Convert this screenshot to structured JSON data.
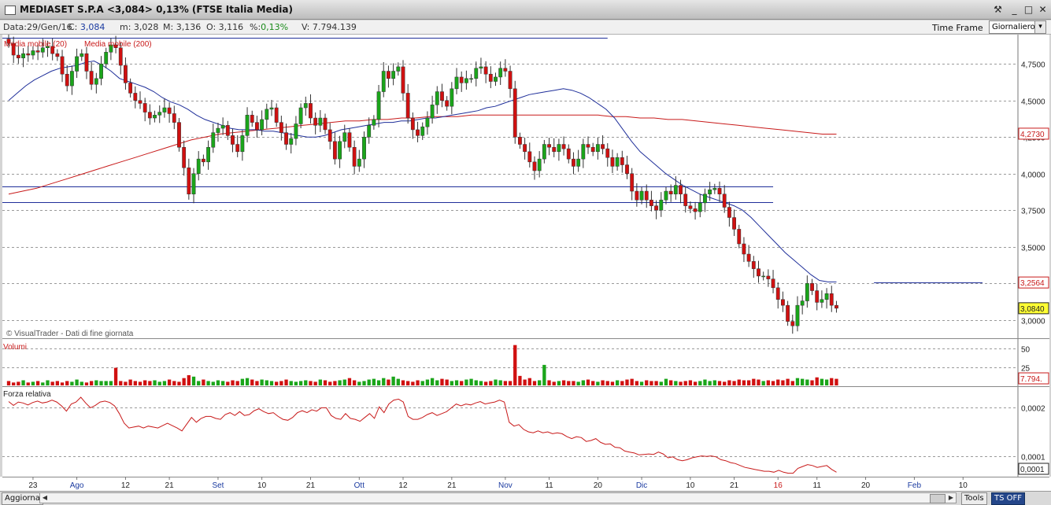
{
  "window": {
    "title": "MEDIASET S.P.A <3,084> 0,13%  (FTSE Italia Media)",
    "controls": [
      "⚒",
      "_",
      "□",
      "✕"
    ]
  },
  "info": {
    "data_label": "Data:",
    "data_value": "29/Gen/16",
    "c_label": "C:",
    "c_value": "3,084",
    "m_label": "m:",
    "m_value": "3,028",
    "M_label": "M:",
    "M_value": "3,136",
    "o_label": "O:",
    "o_value": "3,116",
    "pct_label": "%:",
    "pct_value": "0,13%",
    "v_label": "V:",
    "v_value": "7.794.139"
  },
  "timeframe": {
    "label": "Time Frame",
    "value": "Giornaliero"
  },
  "bottom": {
    "update_button": "Aggiorna",
    "tools_button": "Tools",
    "ts_button": "TS OFF"
  },
  "colors": {
    "up": "#1aa51a",
    "down": "#d01010",
    "ma20": "#1f2f9a",
    "ma200": "#c81a1a",
    "grid": "#9a9a9a"
  },
  "chart_data": [
    {
      "type": "candlestick",
      "legend": [
        "Media mobile (20)",
        "Media mobile (200)"
      ],
      "watermark": "© VisualTrader - Dati di fine giornata",
      "yticks": [
        "4,7500",
        "4,5000",
        "4,2500",
        "4,0000",
        "3,7500",
        "3,5000",
        "3,2500",
        "3,0000"
      ],
      "ylim": [
        2.875,
        4.95
      ],
      "x_labels": [
        "23",
        "Ago",
        "12",
        "21",
        "Set",
        "10",
        "21",
        "Ott",
        "12",
        "21",
        "Nov",
        "11",
        "20",
        "Dic",
        "10",
        "21",
        "16",
        "11",
        "20",
        "Feb",
        "10"
      ],
      "x_label_index": [
        5,
        14,
        24,
        33,
        43,
        52,
        62,
        72,
        81,
        91,
        102,
        111,
        121,
        130,
        140,
        149,
        158,
        166,
        176,
        186,
        196
      ],
      "value_badges": {
        "ma200": "4,2730",
        "ma20": "3,2564",
        "last": "3,0840"
      },
      "ma20_end": 3.256,
      "ma200_end": 4.273,
      "hlines": [
        {
          "level": 4.93,
          "x0": 0,
          "x1": 123
        },
        {
          "level": 3.915,
          "x0": 0,
          "x1": 157
        },
        {
          "level": 3.805,
          "x0": 0,
          "x1": 157
        },
        {
          "level": 3.254,
          "x0": 179,
          "x1": 200
        }
      ],
      "close": [
        4.89,
        4.81,
        4.79,
        4.82,
        4.81,
        4.84,
        4.83,
        4.86,
        4.87,
        4.82,
        4.8,
        4.68,
        4.6,
        4.7,
        4.8,
        4.82,
        4.7,
        4.61,
        4.65,
        4.75,
        4.83,
        4.88,
        4.86,
        4.74,
        4.62,
        4.55,
        4.5,
        4.48,
        4.42,
        4.38,
        4.4,
        4.42,
        4.45,
        4.41,
        4.35,
        4.18,
        4.04,
        3.86,
        4.0,
        4.1,
        4.08,
        4.18,
        4.28,
        4.31,
        4.33,
        4.26,
        4.2,
        4.15,
        4.26,
        4.4,
        4.35,
        4.3,
        4.37,
        4.44,
        4.45,
        4.35,
        4.28,
        4.2,
        4.24,
        4.34,
        4.45,
        4.48,
        4.38,
        4.33,
        4.38,
        4.3,
        4.22,
        4.1,
        4.22,
        4.28,
        4.18,
        4.05,
        4.1,
        4.25,
        4.33,
        4.37,
        4.56,
        4.7,
        4.65,
        4.7,
        4.73,
        4.55,
        4.38,
        4.3,
        4.26,
        4.32,
        4.38,
        4.47,
        4.56,
        4.5,
        4.46,
        4.58,
        4.66,
        4.62,
        4.65,
        4.65,
        4.72,
        4.73,
        4.68,
        4.63,
        4.66,
        4.72,
        4.7,
        4.58,
        4.25,
        4.2,
        4.15,
        4.08,
        4.02,
        4.1,
        4.2,
        4.18,
        4.15,
        4.2,
        4.17,
        4.1,
        4.05,
        4.1,
        4.2,
        4.18,
        4.15,
        4.2,
        4.17,
        4.11,
        4.05,
        4.11,
        4.06,
        4.0,
        3.88,
        3.82,
        3.88,
        3.82,
        3.78,
        3.75,
        3.82,
        3.88,
        3.86,
        3.92,
        3.86,
        3.78,
        3.76,
        3.74,
        3.8,
        3.86,
        3.89,
        3.9,
        3.86,
        3.77,
        3.7,
        3.62,
        3.52,
        3.45,
        3.4,
        3.35,
        3.3,
        3.3,
        3.28,
        3.22,
        3.14,
        3.1,
        2.99,
        2.96,
        3.1,
        3.13,
        3.25,
        3.2,
        3.12,
        3.14,
        3.18,
        3.1,
        3.08
      ],
      "ma20": [
        4.5,
        4.55,
        4.6,
        4.64,
        4.67,
        4.7,
        4.72,
        4.73,
        4.74,
        4.76,
        4.77,
        4.74,
        4.7,
        4.65,
        4.63,
        4.61,
        4.59,
        4.56,
        4.52,
        4.49,
        4.47,
        4.44,
        4.4,
        4.37,
        4.35,
        4.33,
        4.31,
        4.3,
        4.3,
        4.3,
        4.29,
        4.29,
        4.28,
        4.27,
        4.26,
        4.25,
        4.25,
        4.26,
        4.28,
        4.3,
        4.31,
        4.32,
        4.33,
        4.34,
        4.35,
        4.35,
        4.36,
        4.36,
        4.37,
        4.38,
        4.38,
        4.39,
        4.4,
        4.41,
        4.42,
        4.43,
        4.45,
        4.46,
        4.48,
        4.5,
        4.52,
        4.54,
        4.55,
        4.56,
        4.57,
        4.58,
        4.57,
        4.55,
        4.52,
        4.48,
        4.44,
        4.38,
        4.3,
        4.22,
        4.15,
        4.1,
        4.05,
        4.0,
        3.96,
        3.92,
        3.89,
        3.86,
        3.84,
        3.82,
        3.8,
        3.78,
        3.75,
        3.7,
        3.64,
        3.58,
        3.52,
        3.46,
        3.41,
        3.36,
        3.31,
        3.27,
        3.26,
        3.26
      ],
      "ma200": [
        3.86,
        3.88,
        3.9,
        3.93,
        3.96,
        3.99,
        4.02,
        4.05,
        4.08,
        4.11,
        4.14,
        4.17,
        4.2,
        4.23,
        4.25,
        4.27,
        4.28,
        4.29,
        4.3,
        4.31,
        4.32,
        4.33,
        4.34,
        4.35,
        4.36,
        4.36,
        4.37,
        4.37,
        4.38,
        4.38,
        4.39,
        4.39,
        4.39,
        4.4,
        4.4,
        4.4,
        4.4,
        4.4,
        4.4,
        4.4,
        4.4,
        4.4,
        4.4,
        4.39,
        4.39,
        4.38,
        4.38,
        4.37,
        4.37,
        4.36,
        4.35,
        4.34,
        4.33,
        4.32,
        4.31,
        4.3,
        4.29,
        4.28,
        4.27,
        4.27
      ],
      "ma200_start": 0
    },
    {
      "type": "bar",
      "title": "Volumi",
      "yticks": [
        "50",
        "25"
      ],
      "ylim": [
        0,
        60
      ],
      "value_badge": "7.794.",
      "values": [
        6,
        4,
        5,
        7,
        4,
        5,
        6,
        4,
        7,
        5,
        6,
        4,
        6,
        5,
        8,
        5,
        4,
        6,
        7,
        6,
        6,
        6,
        24,
        6,
        5,
        8,
        6,
        5,
        7,
        6,
        7,
        5,
        6,
        8,
        6,
        5,
        10,
        14,
        12,
        6,
        8,
        6,
        5,
        7,
        6,
        5,
        7,
        6,
        9,
        10,
        8,
        6,
        8,
        7,
        6,
        5,
        6,
        8,
        6,
        5,
        6,
        7,
        6,
        5,
        8,
        7,
        5,
        6,
        7,
        8,
        10,
        7,
        5,
        6,
        8,
        9,
        7,
        10,
        8,
        12,
        9,
        7,
        6,
        5,
        7,
        6,
        8,
        10,
        7,
        9,
        8,
        6,
        7,
        6,
        8,
        9,
        7,
        6,
        5,
        6,
        8,
        7,
        6,
        6,
        55,
        13,
        8,
        10,
        6,
        7,
        28,
        7,
        5,
        6,
        7,
        6,
        6,
        5,
        7,
        8,
        6,
        5,
        7,
        6,
        5,
        7,
        6,
        8,
        9,
        6,
        5,
        7,
        6,
        6,
        5,
        9,
        7,
        6,
        5,
        6,
        7,
        5,
        6,
        8,
        6,
        7,
        6,
        5,
        7,
        6,
        8,
        7,
        7,
        9,
        8,
        6,
        7,
        6,
        8,
        7,
        9,
        6,
        10,
        9,
        8,
        7,
        11,
        9,
        8,
        10,
        9,
        6,
        7,
        6,
        5,
        7
      ]
    },
    {
      "type": "line",
      "title": "Forza relativa",
      "yticks": [
        "0,0002",
        "0,0001"
      ],
      "value_badge": "0,0001",
      "ylim": [
        6e-05,
        0.00024
      ],
      "values": [
        0.000213,
        0.000205,
        0.000212,
        0.00021,
        0.000206,
        0.000211,
        0.000214,
        0.00021,
        0.000212,
        0.000216,
        0.000212,
        0.000204,
        0.000193,
        0.000208,
        0.000212,
        0.000222,
        0.00021,
        0.0002,
        0.000205,
        0.000212,
        0.000214,
        0.000211,
        0.000204,
        0.000188,
        0.000168,
        0.000158,
        0.00016,
        0.000162,
        0.000158,
        0.000162,
        0.00016,
        0.000158,
        0.000163,
        0.000168,
        0.000163,
        0.000158,
        0.000152,
        0.000166,
        0.00018,
        0.00017,
        0.000178,
        0.000182,
        0.000182,
        0.000178,
        0.000176,
        0.000186,
        0.00019,
        0.000184,
        0.000192,
        0.000184,
        0.000186,
        0.000194,
        0.000198,
        0.000192,
        0.000188,
        0.00019,
        0.000182,
        0.000176,
        0.000174,
        0.00018,
        0.00019,
        0.000194,
        0.00019,
        0.000196,
        0.000193,
        0.0002,
        0.0002,
        0.000184,
        0.000178,
        0.000176,
        0.000188,
        0.000178,
        0.000176,
        0.000172,
        0.00018,
        0.000188,
        0.000178,
        0.000202,
        0.00019,
        0.000208,
        0.000216,
        0.000218,
        0.000212,
        0.000182,
        0.000176,
        0.000176,
        0.00018,
        0.000186,
        0.00019,
        0.000184,
        0.000188,
        0.000192,
        0.0002,
        0.000208,
        0.000204,
        0.000208,
        0.000206,
        0.00021,
        0.000213,
        0.000208,
        0.00021,
        0.000212,
        0.000216,
        0.000212,
        0.00017,
        0.000162,
        0.000165,
        0.000155,
        0.00015,
        0.000148,
        0.000152,
        0.000148,
        0.00015,
        0.000146,
        0.000148,
        0.000146,
        0.00014,
        0.000136,
        0.00014,
        0.000138,
        0.00013,
        0.000132,
        0.000136,
        0.000128,
        0.000124,
        0.000125,
        0.000118,
        0.000117,
        0.00011,
        0.000108,
        0.000106,
        0.000102,
        0.000103,
        0.000104,
        0.000103,
        0.000108,
        0.000104,
        9.6e-05,
        9.8e-05,
        9.2e-05,
        9e-05,
        9.2e-05,
        9.6e-05,
        9.8e-05,
        0.0001,
        9.9e-05,
        0.0001,
        9.8e-05,
        9.2e-05,
        9e-05,
        8.6e-05,
        8.4e-05,
        8e-05,
        7.6e-05,
        7.4e-05,
        7.2e-05,
        7e-05,
        6.8e-05,
        6.8e-05,
        6.6e-05,
        7e-05,
        6.6e-05,
        6.4e-05,
        6.4e-05,
        7.4e-05,
        7.8e-05,
        8.2e-05,
        8e-05,
        7.6e-05,
        7.8e-05,
        8e-05,
        7.2e-05,
        6.6e-05
      ]
    }
  ]
}
